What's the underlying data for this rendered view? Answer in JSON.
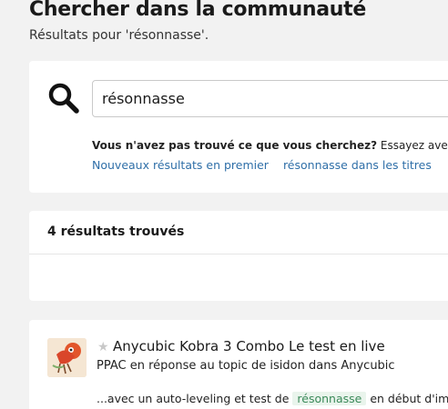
{
  "header": {
    "title": "Chercher dans la communauté",
    "subtitle": "Résultats pour 'résonnasse'."
  },
  "search": {
    "query": "résonnasse",
    "icon": "search-icon",
    "not_found_prompt": "Vous n'avez pas trouvé ce que vous cherchez?",
    "try_with": "Essayez avec:",
    "suggestions": [
      {
        "label": "Nouveaux résultats en premier"
      },
      {
        "label": "résonnasse dans les titres"
      }
    ]
  },
  "results": {
    "count_label": "4 résultats trouvés",
    "items": [
      {
        "title": "Anycubic Kobra 3 Combo Le test en live",
        "meta": "PPAC en réponse au topic de isidon dans Anycubic",
        "excerpt_before": "...avec un auto-leveling et test de",
        "excerpt_highlight": "résonnasse",
        "excerpt_after": "en début d'impr",
        "star_icon": "star-icon",
        "avatar_icon": "avatar"
      }
    ]
  },
  "colors": {
    "link": "#2f6fa8",
    "highlight_bg": "#e9f4ec",
    "highlight_text": "#3c8a5a",
    "page_bg": "#f2f2f2"
  }
}
